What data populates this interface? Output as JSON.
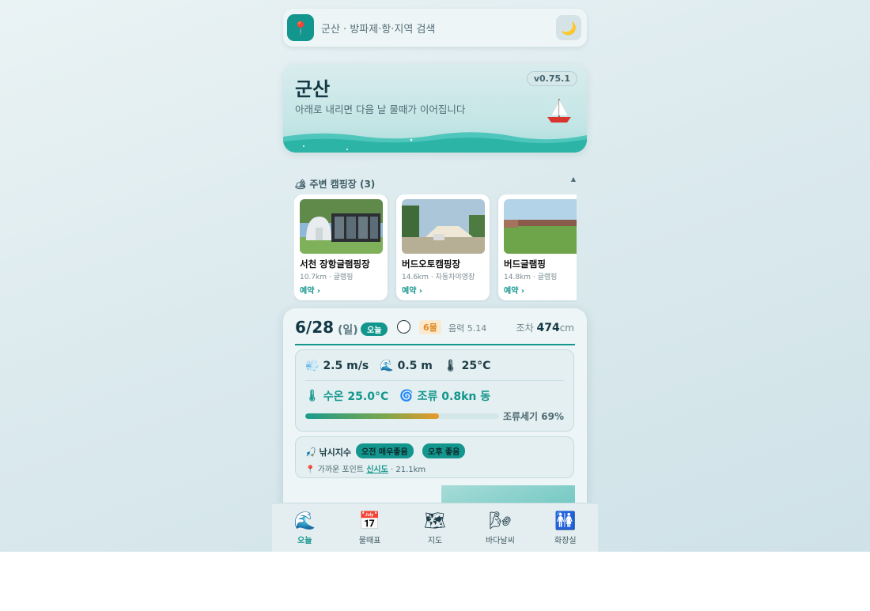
{
  "search": {
    "placeholder": "군산 · 방파제·항·지역 검색",
    "pin_icon": "📍",
    "moon_icon": "🌙"
  },
  "hero": {
    "city": "군산",
    "subtitle": "아래로 내리면 다음 날 물때가 이어집니다",
    "version": "v0.75.1"
  },
  "camping": {
    "title": "🏕 주변 캠핑장 (3)",
    "collapse_icon": "▲",
    "items": [
      {
        "name": "서천 장항글램핑장",
        "meta": "10.7km · 글램핑",
        "book": "예약 ›"
      },
      {
        "name": "버드오토캠핑장",
        "meta": "14.6km · 자동차야영장",
        "book": "예약 ›"
      },
      {
        "name": "버드글램핑",
        "meta": "14.8km · 글램핑",
        "book": "예약 ›"
      }
    ]
  },
  "day": {
    "date": "6/28",
    "weekday": "(일)",
    "today_badge": "오늘",
    "tide_name": "6물",
    "lunar": "음력 5.14",
    "range_label": "조차",
    "range_value": "474",
    "range_unit": "cm",
    "weather": {
      "wind_icon": "💨",
      "wind": "2.5 m/s",
      "wave_icon": "🌊",
      "wave": "0.5 m",
      "temp_icon": "🌡",
      "temp": "25°C",
      "water_icon": "🌡",
      "water_temp": "수온 25.0°C",
      "current_icon": "🌀",
      "current": "조류 0.8kn 동",
      "current_strength_label": "조류세기 69%",
      "current_strength_pct": 69
    },
    "fishing": {
      "title": "🎣 낚시지수",
      "am": "오전 매우좋음",
      "pm": "오후 좋음",
      "point_prefix": "📍 가까운 포인트",
      "point_name": "신시도",
      "point_dist": "· 21.1km"
    }
  },
  "nav": [
    {
      "icon": "🌊",
      "label": "오늘",
      "active": true
    },
    {
      "icon": "📅",
      "label": "물때표",
      "active": false
    },
    {
      "icon": "🗺",
      "label": "지도",
      "active": false
    },
    {
      "icon": "🌬",
      "label": "바다날씨",
      "active": false
    },
    {
      "icon": "🚻",
      "label": "화장실",
      "active": false
    }
  ],
  "colors": {
    "accent": "#13968d",
    "tide_badge": "#e08a24",
    "text_dark": "#123844"
  }
}
